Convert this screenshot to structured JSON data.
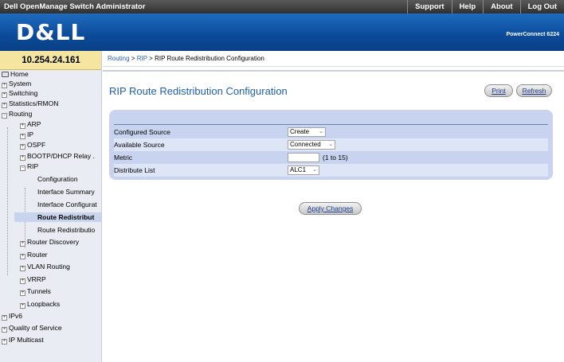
{
  "app": {
    "title": "Dell OpenManage Switch Administrator",
    "top_links": [
      "Support",
      "Help",
      "About",
      "Log Out"
    ],
    "brand": "D&LL",
    "model": "PowerConnect 6224"
  },
  "nav": {
    "ip_address": "10.254.24.161",
    "items": [
      {
        "label": "Home",
        "icon": "home-icon"
      },
      {
        "label": "System"
      },
      {
        "label": "Switching"
      },
      {
        "label": "Statistics/RMON"
      },
      {
        "label": "Routing"
      },
      {
        "label": "ARP"
      },
      {
        "label": "IP"
      },
      {
        "label": "OSPF"
      },
      {
        "label": "BOOTP/DHCP Relay ."
      },
      {
        "label": "RIP"
      },
      {
        "label": "Configuration"
      },
      {
        "label": "Interface Summary"
      },
      {
        "label": "Interface Configurat"
      },
      {
        "label": "Route Redistribut"
      },
      {
        "label": "Route Redistributio"
      },
      {
        "label": "Router Discovery"
      },
      {
        "label": "Router"
      },
      {
        "label": "VLAN Routing"
      },
      {
        "label": "VRRP"
      },
      {
        "label": "Tunnels"
      },
      {
        "label": "Loopbacks"
      },
      {
        "label": "IPv6"
      },
      {
        "label": "Quality of Service"
      },
      {
        "label": "IP Multicast"
      }
    ]
  },
  "breadcrumb": {
    "items": [
      "Routing",
      "RIP",
      "RIP Route Redistribution Configuration"
    ],
    "separator": ">"
  },
  "page": {
    "title": "RIP Route Redistribution Configuration",
    "print_label": "Print",
    "refresh_label": "Refresh",
    "apply_label": "Apply Changes"
  },
  "form": {
    "configured_source": {
      "label": "Configured Source",
      "value": "Create"
    },
    "available_source": {
      "label": "Available Source",
      "value": "Connected"
    },
    "metric": {
      "label": "Metric",
      "value": "",
      "hint": "(1 to 15)"
    },
    "distribute_list": {
      "label": "Distribute List",
      "value": "ALC1"
    }
  },
  "colors": {
    "brand_blue": "#0b4a99",
    "title_blue": "#1f5fa8",
    "panel_bg": "#c8d3ef",
    "ip_box_bg": "#f4e6a0"
  }
}
